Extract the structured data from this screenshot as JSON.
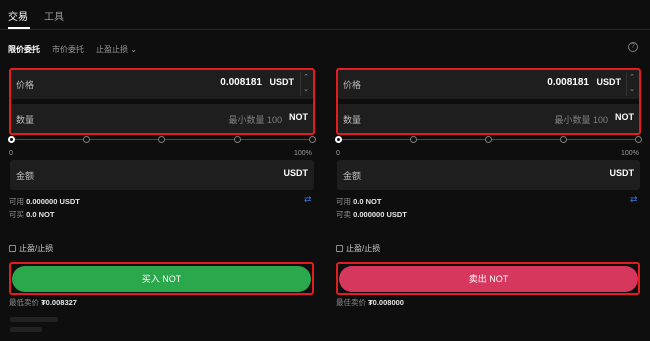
{
  "top_tabs": {
    "trade": "交易",
    "tools": "工具"
  },
  "order_types": {
    "limit": "限价委托",
    "market": "市价委托",
    "stop": "止盈止损 ⌄",
    "help": "?"
  },
  "buy": {
    "price_label": "价格",
    "price_value": "0.008181",
    "price_unit": "USDT",
    "qty_label": "数量",
    "qty_placeholder": "最小数量 100",
    "qty_unit": "NOT",
    "slider_min": "0",
    "slider_max": "100%",
    "amount_label": "金额",
    "amount_unit": "USDT",
    "available_label": "可用",
    "available_value": "0.000000 USDT",
    "can_buy_label": "可买",
    "can_buy_value": "0.0 NOT",
    "tpsl_label": "止盈/止损",
    "button_label": "买入 NOT",
    "best_label": "最低卖价",
    "best_value": "₮0.008327"
  },
  "sell": {
    "price_label": "价格",
    "price_value": "0.008181",
    "price_unit": "USDT",
    "qty_label": "数量",
    "qty_placeholder": "最小数量 100",
    "qty_unit": "NOT",
    "slider_min": "0",
    "slider_max": "100%",
    "amount_label": "金额",
    "amount_unit": "USDT",
    "available_label": "可用",
    "available_value": "0.0 NOT",
    "can_sell_label": "可卖",
    "can_sell_value": "0.000000 USDT",
    "tpsl_label": "止盈/止损",
    "button_label": "卖出 NOT",
    "best_label": "最佳卖价",
    "best_value": "₮0.008000"
  },
  "icons": {
    "stepper_up": "⌃",
    "stepper_down": "⌄",
    "swap": "⇄"
  },
  "colors": {
    "buy": "#2aa84b",
    "sell": "#d6375d",
    "highlight": "#e31d1d",
    "link": "#3a78d8"
  }
}
